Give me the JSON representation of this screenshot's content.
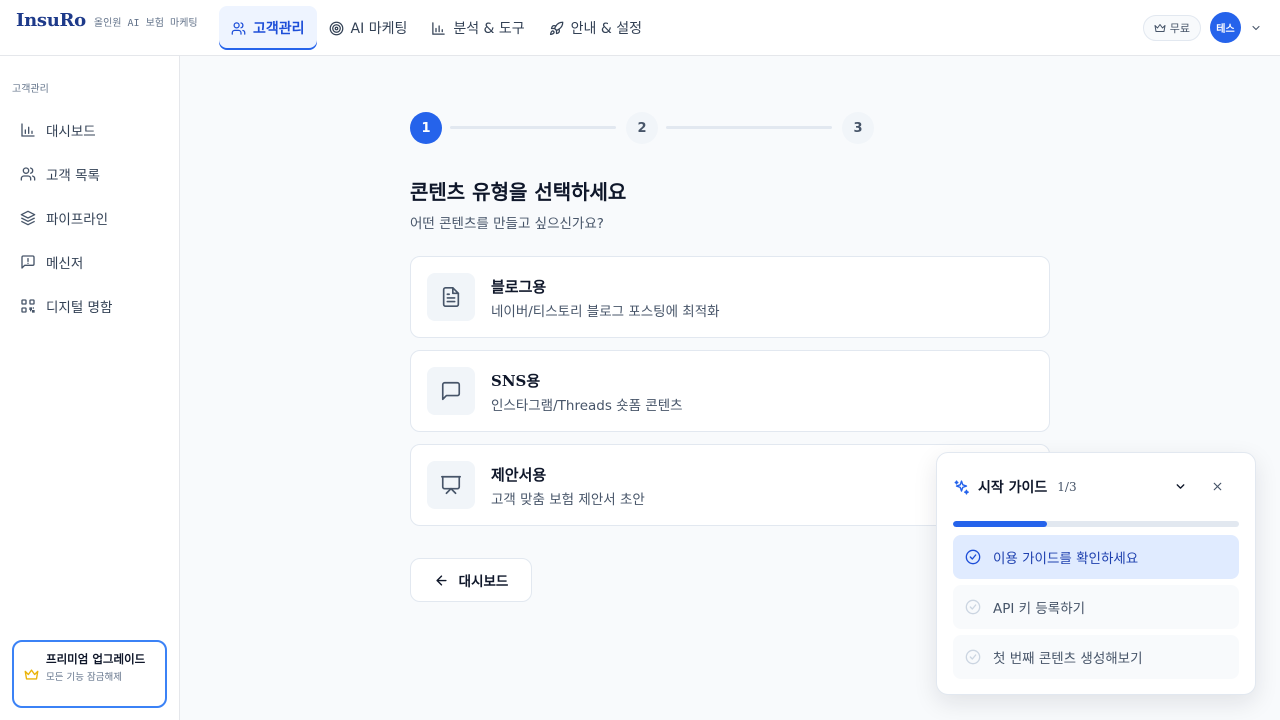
{
  "brand": {
    "logo": "InsuRo",
    "tagline": "올인원 AI 보험 마케팅"
  },
  "nav": [
    {
      "label": "고객관리",
      "icon": "users-icon",
      "active": true
    },
    {
      "label": "AI 마케팅",
      "icon": "target-icon",
      "active": false
    },
    {
      "label": "분석 & 도구",
      "icon": "bar-chart-icon",
      "active": false
    },
    {
      "label": "안내 & 설정",
      "icon": "rocket-icon",
      "active": false
    }
  ],
  "header": {
    "plan_label": "무료",
    "avatar_text": "테스"
  },
  "sidebar": {
    "section_label": "고객관리",
    "items": [
      {
        "label": "대시보드",
        "icon": "bar-chart-icon"
      },
      {
        "label": "고객 목록",
        "icon": "users-icon"
      },
      {
        "label": "파이프라인",
        "icon": "layers-icon"
      },
      {
        "label": "메신저",
        "icon": "message-alert-icon"
      },
      {
        "label": "디지털 명함",
        "icon": "qr-code-icon"
      }
    ],
    "premium": {
      "title": "프리미엄 업그레이드",
      "subtitle": "모든 기능 잠금해제"
    }
  },
  "stepper": {
    "steps": [
      "1",
      "2",
      "3"
    ],
    "current": 1
  },
  "main": {
    "title": "콘텐츠 유형을 선택하세요",
    "subtitle": "어떤 콘텐츠를 만들고 싶으신가요?",
    "options": [
      {
        "title": "블로그용",
        "desc": "네이버/티스토리 블로그 포스팅에 최적화",
        "icon": "file-text-icon"
      },
      {
        "title_latin": "SNS",
        "title_suffix": "용",
        "desc": "인스타그램/Threads 숏폼 콘텐츠",
        "icon": "message-square-icon"
      },
      {
        "title": "제안서용",
        "desc": "고객 맞춤 보험 제안서 초안",
        "icon": "presentation-icon"
      }
    ],
    "back_label": "대시보드"
  },
  "guide": {
    "title": "시작 가이드",
    "count": "1/3",
    "progress": 0.33,
    "items": [
      {
        "label": "이용 가이드를 확인하세요",
        "state": "current"
      },
      {
        "label": "API 키 등록하기",
        "state": "pending"
      },
      {
        "label": "첫 번째 콘텐츠 생성해보기",
        "state": "pending"
      }
    ]
  },
  "colors": {
    "accent": "#2563eb",
    "brand": "#1e3a8a",
    "premium_icon": "#eab308"
  }
}
